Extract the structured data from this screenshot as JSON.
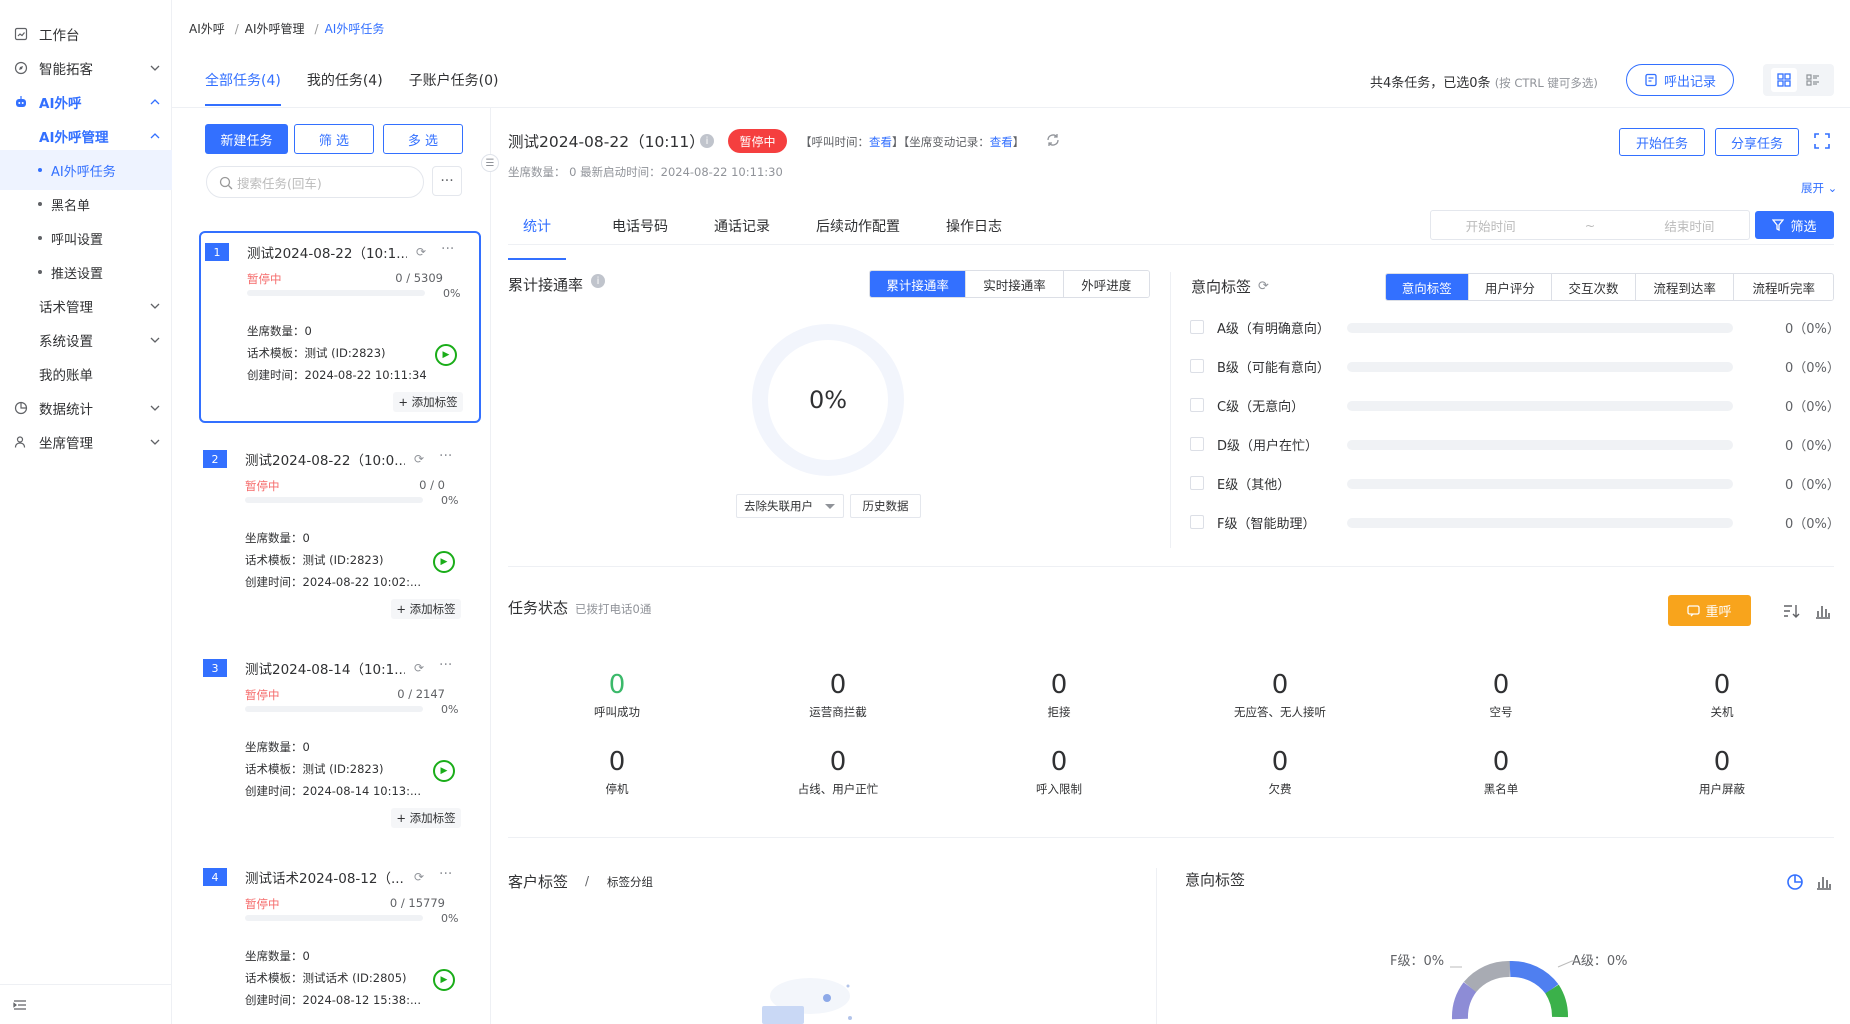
{
  "sidebar": {
    "items": [
      {
        "label": "工作台",
        "icon": "dashboard-icon"
      },
      {
        "label": "智能拓客",
        "icon": "compass-icon"
      },
      {
        "label": "AI外呼",
        "icon": "robot-icon"
      },
      {
        "label": "AI外呼管理"
      },
      {
        "label": "AI外呼任务"
      },
      {
        "label": "黑名单"
      },
      {
        "label": "呼叫设置"
      },
      {
        "label": "推送设置"
      },
      {
        "label": "话术管理"
      },
      {
        "label": "系统设置"
      },
      {
        "label": "我的账单"
      },
      {
        "label": "数据统计",
        "icon": "chart-pie-icon"
      },
      {
        "label": "坐席管理",
        "icon": "agent-icon"
      }
    ]
  },
  "breadcrumb": [
    "AI外呼",
    "AI外呼管理",
    "AI外呼任务"
  ],
  "left_tabs": [
    "全部任务(4)",
    "我的任务(4)",
    "子账户任务(0)"
  ],
  "selection_info": "共4条任务，已选0条",
  "selection_hint": "(按 CTRL 键可多选)",
  "call_records_label": "呼出记录",
  "toolbar": {
    "new_task": "新建任务",
    "filter": "筛 选",
    "multi": "多 选",
    "more": "···"
  },
  "search": {
    "placeholder": "搜索任务(回车)"
  },
  "tasks": [
    {
      "no": "1",
      "title": "测试2024-08-22（10:1...",
      "status": "暂停中",
      "count": "0 / 5309",
      "pct": "0%",
      "seats": "坐席数量：0",
      "template": "话术模板：测试 (ID:2823)",
      "created": "创建时间：2024-08-22 10:11:34",
      "add_tag": "+ 添加标签"
    },
    {
      "no": "2",
      "title": "测试2024-08-22（10:0...",
      "status": "暂停中",
      "count": "0 / 0",
      "pct": "0%",
      "seats": "坐席数量：0",
      "template": "话术模板：测试 (ID:2823)",
      "created": "创建时间：2024-08-22 10:02:...",
      "add_tag": "+ 添加标签"
    },
    {
      "no": "3",
      "title": "测试2024-08-14（10:1...",
      "status": "暂停中",
      "count": "0 / 2147",
      "pct": "0%",
      "seats": "坐席数量：0",
      "template": "话术模板：测试 (ID:2823)",
      "created": "创建时间：2024-08-14 10:13:...",
      "add_tag": "+ 添加标签"
    },
    {
      "no": "4",
      "title": "测试话术2024-08-12（...",
      "status": "暂停中",
      "count": "0 / 15779",
      "pct": "0%",
      "seats": "坐席数量：0",
      "template": "话术模板：测试话术 (ID:2805)",
      "created": "创建时间：2024-08-12 15:38:...",
      "add_tag": ""
    }
  ],
  "detail": {
    "title": "测试2024-08-22（10:11）",
    "status": "暂停中",
    "call_time_label": "【呼叫时间：",
    "view": "查看",
    "seat_change_label": "】【坐席变动记录：",
    "close_bracket": "】",
    "sub": "坐席数量：  0      最新启动时间：2024-08-22 10:11:30",
    "start": "开始任务",
    "share": "分享任务",
    "expand": "展开",
    "tabs": [
      "统计",
      "电话号码",
      "通话记录",
      "后续动作配置",
      "操作日志"
    ],
    "date_start": "开始时间",
    "date_sep": "~",
    "date_end": "结束时间",
    "filter": "筛选"
  },
  "connect": {
    "title": "累计接通率",
    "seg": [
      "累计接通率",
      "实时接通率",
      "外呼进度"
    ],
    "value": "0%",
    "drop": "去除失联用户",
    "history": "历史数据"
  },
  "intent": {
    "title": "意向标签",
    "seg": [
      "意向标签",
      "用户评分",
      "交互次数",
      "流程到达率",
      "流程听完率"
    ],
    "rows": [
      {
        "name": "A级（有明确意向）",
        "value": "0（0%）"
      },
      {
        "name": "B级（可能有意向）",
        "value": "0（0%）"
      },
      {
        "name": "C级（无意向）",
        "value": "0（0%）"
      },
      {
        "name": "D级（用户在忙）",
        "value": "0（0%）"
      },
      {
        "name": "E级（其他）",
        "value": "0（0%）"
      },
      {
        "name": "F级（智能助理）",
        "value": "0（0%）"
      }
    ]
  },
  "task_status": {
    "title": "任务状态",
    "sub": "已拨打电话0通",
    "redial": "重呼",
    "stats": [
      {
        "n": "0",
        "l": "呼叫成功"
      },
      {
        "n": "0",
        "l": "运营商拦截"
      },
      {
        "n": "0",
        "l": "拒接"
      },
      {
        "n": "0",
        "l": "无应答、无人接听"
      },
      {
        "n": "0",
        "l": "空号"
      },
      {
        "n": "0",
        "l": "关机"
      },
      {
        "n": "0",
        "l": "停机"
      },
      {
        "n": "0",
        "l": "占线、用户正忙"
      },
      {
        "n": "0",
        "l": "呼入限制"
      },
      {
        "n": "0",
        "l": "欠费"
      },
      {
        "n": "0",
        "l": "黑名单"
      },
      {
        "n": "0",
        "l": "用户屏蔽"
      }
    ]
  },
  "customer_tags": {
    "title": "客户标签",
    "sep": "/",
    "group": "标签分组"
  },
  "intent_chart": {
    "title": "意向标签",
    "f_label": "F级：0%",
    "a_label": "A级：0%"
  }
}
